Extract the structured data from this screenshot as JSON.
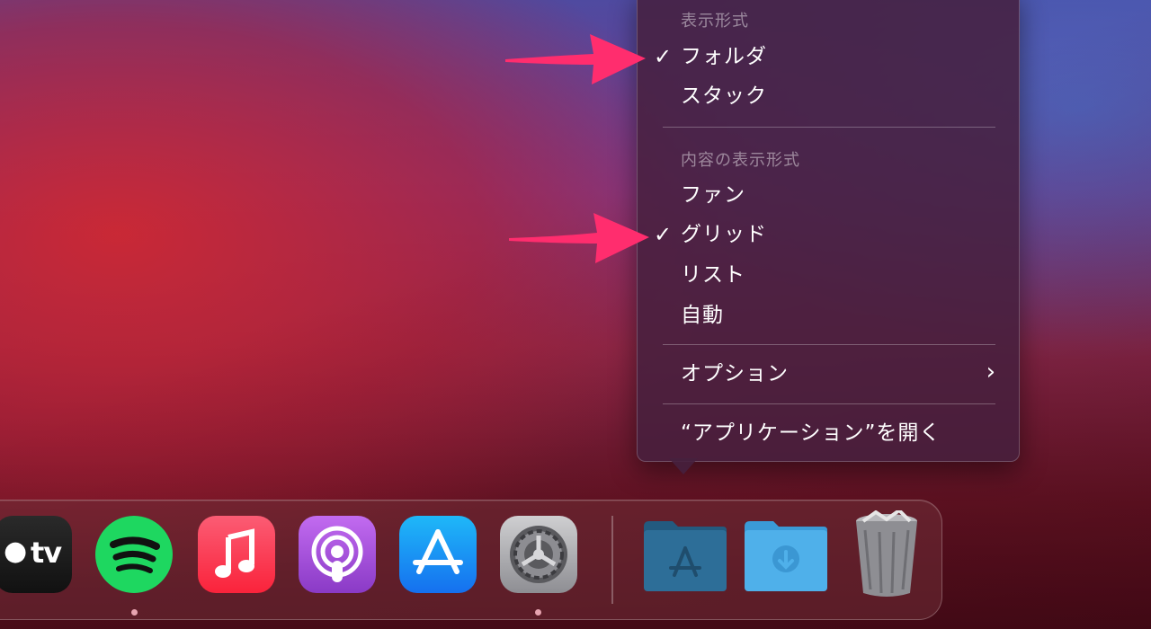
{
  "menu": {
    "section1_header": "表示形式",
    "section1_items": [
      {
        "label": "フォルダ",
        "checked": true
      },
      {
        "label": "スタック",
        "checked": false
      }
    ],
    "section2_header": "内容の表示形式",
    "section2_items": [
      {
        "label": "ファン",
        "checked": false
      },
      {
        "label": "グリッド",
        "checked": true
      },
      {
        "label": "リスト",
        "checked": false
      },
      {
        "label": "自動",
        "checked": false
      }
    ],
    "options_label": "オプション",
    "open_label": "“アプリケーション”を開く",
    "check_glyph": "✓",
    "chevron_glyph": "›"
  },
  "dock": {
    "apps": [
      {
        "name": "Apple TV",
        "label": "tv",
        "running": false
      },
      {
        "name": "Spotify",
        "running": true
      },
      {
        "name": "Music",
        "running": false
      },
      {
        "name": "Podcasts",
        "running": false
      },
      {
        "name": "App Store",
        "running": true
      },
      {
        "name": "System Preferences",
        "running": false
      }
    ],
    "stacks": [
      {
        "name": "Applications folder",
        "icon": "app-store-folder-icon"
      },
      {
        "name": "Downloads folder",
        "icon": "download-folder-icon"
      },
      {
        "name": "Trash",
        "icon": "trash-icon"
      }
    ]
  },
  "colors": {
    "arrow": "#ff2d6e",
    "spotify": "#1ed760",
    "music_top": "#fb5c74",
    "music_bottom": "#fa233b",
    "podcasts": "#a053d8",
    "appstore": "#1e8ef5",
    "folder_dark": "#2d6e98",
    "folder_light": "#4fb0ea"
  }
}
